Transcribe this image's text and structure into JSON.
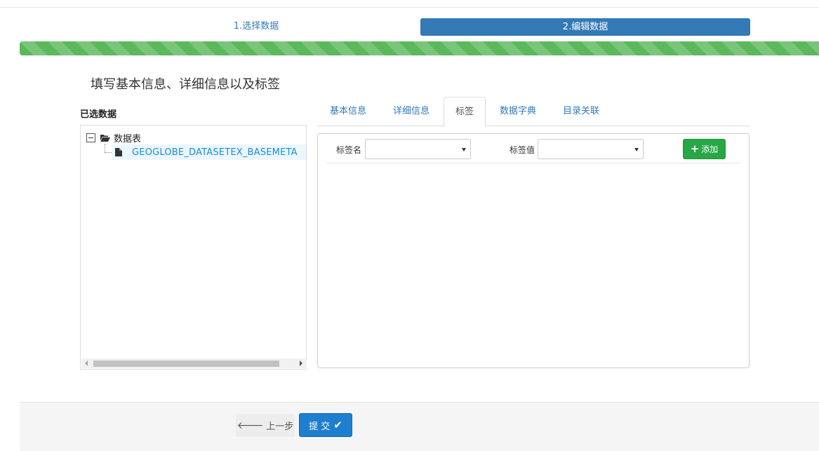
{
  "steps": {
    "step1_label": "1.选择数据",
    "step2_label": "2.编辑数据",
    "progress_percent": 100
  },
  "colors": {
    "primary": "#337ab7",
    "progress": "#5cb85c",
    "add_button": "#28a745",
    "submit_button": "#1e7ecf",
    "link": "#1a8fd6"
  },
  "page": {
    "heading": "填写基本信息、详细信息以及标签"
  },
  "selected": {
    "label": "已选数据",
    "tree": {
      "root_label": "数据表",
      "root_icon": "folder-open-icon",
      "children": [
        {
          "label": "GEOGLOBE_DATASETEX_BASEMETA",
          "icon": "file-icon"
        }
      ]
    }
  },
  "tabs": [
    {
      "label": "基本信息",
      "active": false
    },
    {
      "label": "详细信息",
      "active": false
    },
    {
      "label": "标签",
      "active": true
    },
    {
      "label": "数据字典",
      "active": false
    },
    {
      "label": "目录关联",
      "active": false
    }
  ],
  "tag_form": {
    "tag_name_label": "标签名",
    "tag_name_value": "",
    "tag_value_label": "标签值",
    "tag_value_value": "",
    "add_label": "添加"
  },
  "footer": {
    "prev_label": "上一步",
    "submit_label": "提 交"
  }
}
